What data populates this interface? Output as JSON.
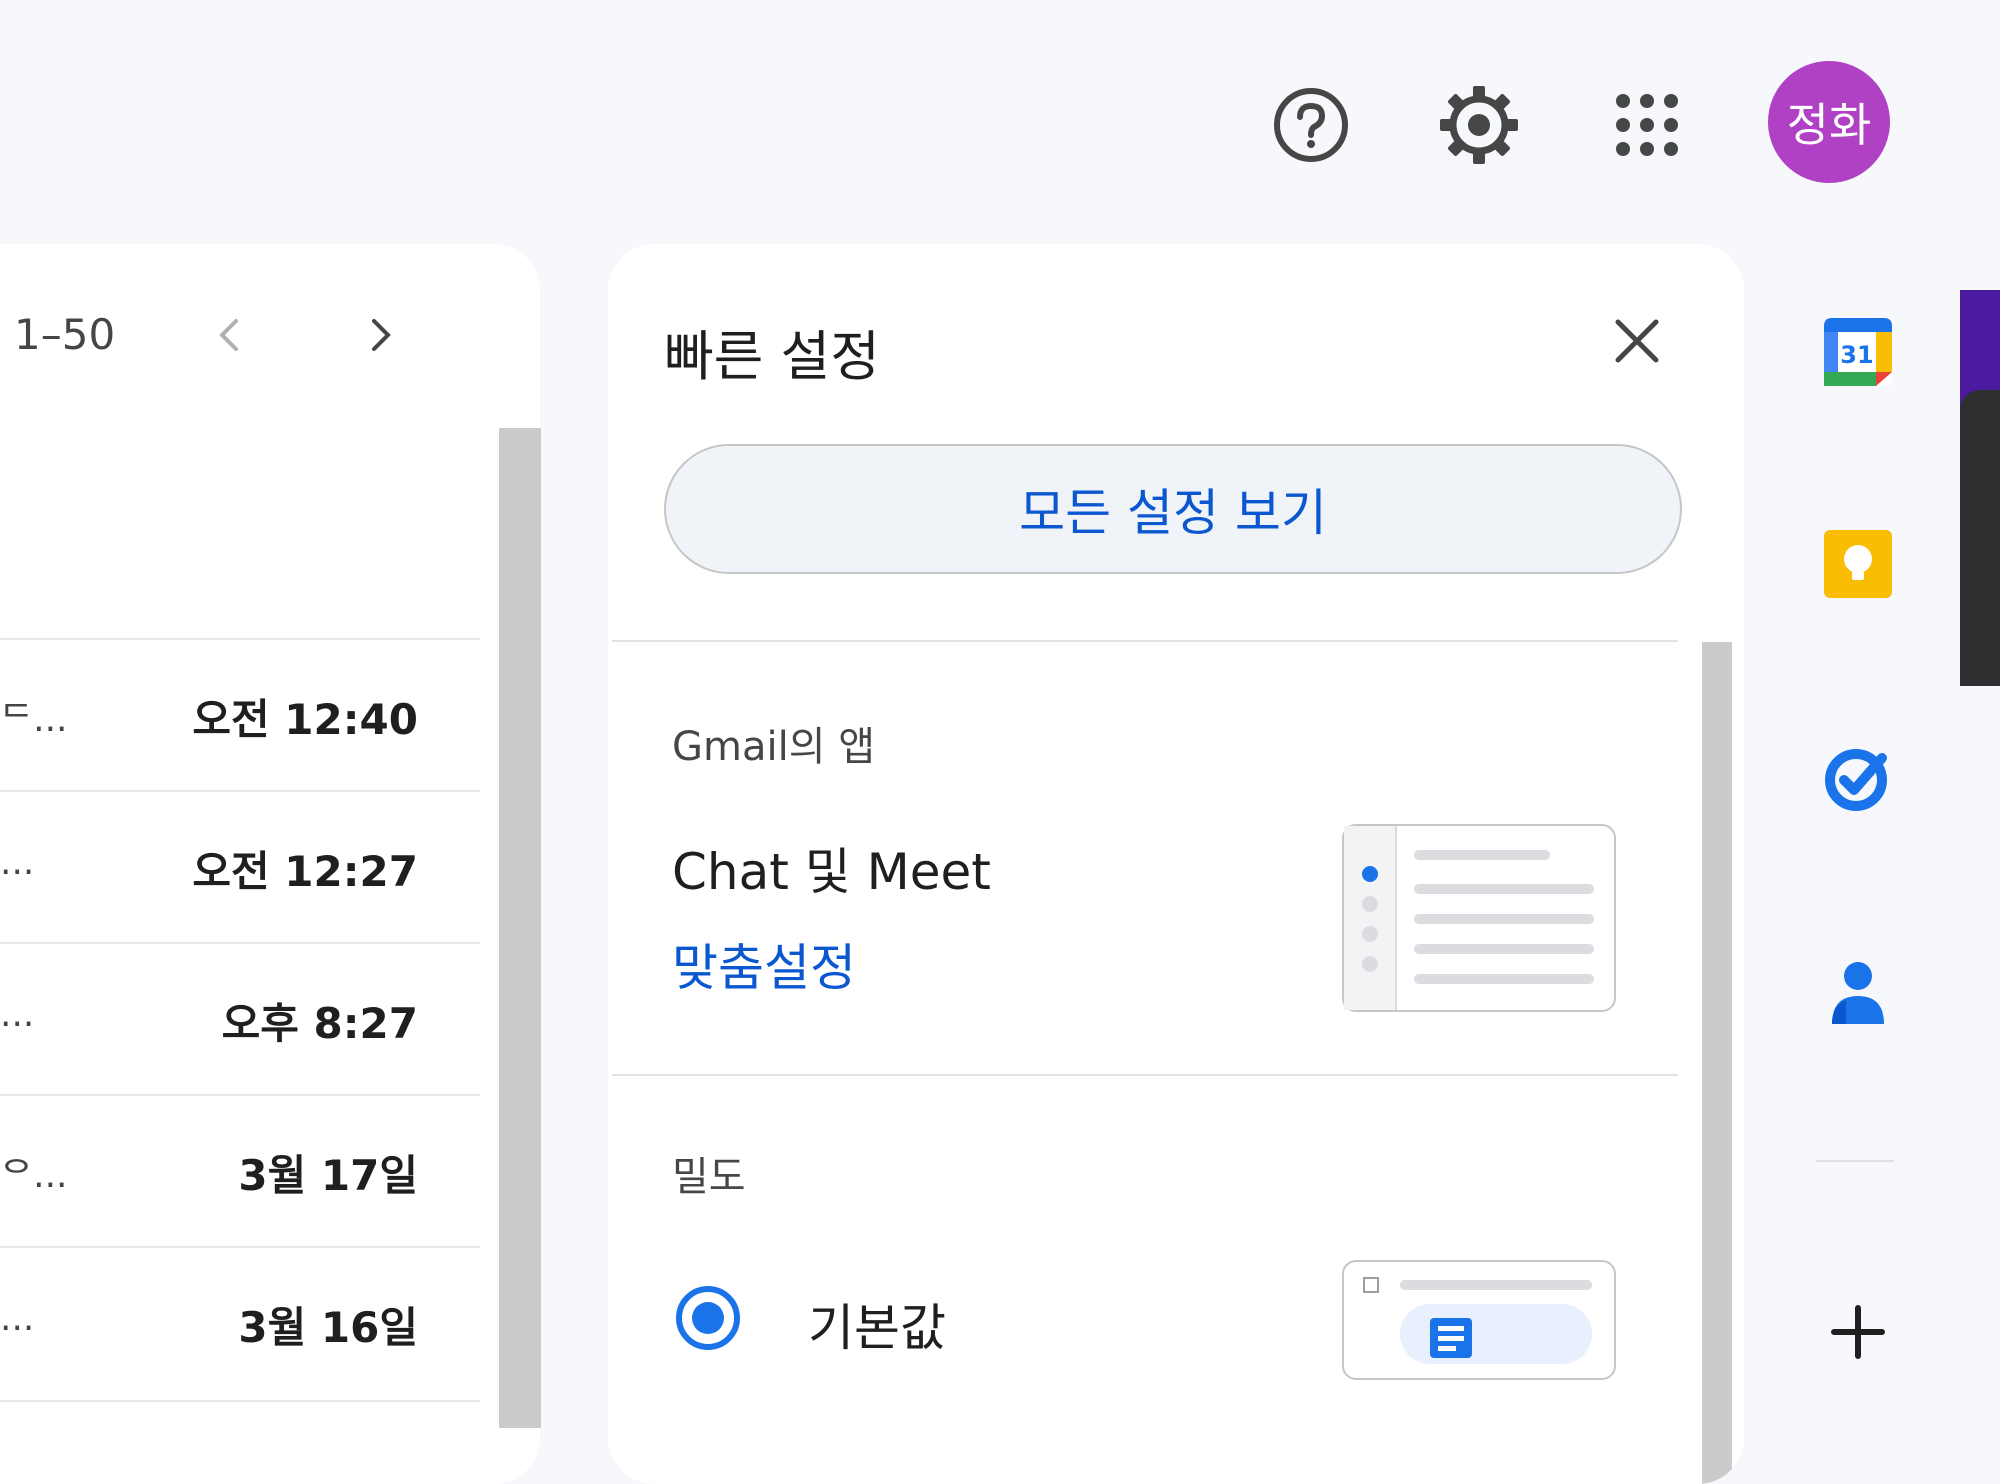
{
  "header": {
    "help_icon": "help-circle-icon",
    "settings_icon": "gear-icon",
    "apps_icon": "apps-grid-icon",
    "avatar_text": "정화",
    "avatar_color": "#b040c4"
  },
  "mail_list": {
    "pager": "1–50",
    "rows": [
      {
        "snippet": "ᄃ...",
        "time": "오전 12:40"
      },
      {
        "snippet": "...",
        "time": "오전 12:27"
      },
      {
        "snippet": "...",
        "time": "오후 8:27"
      },
      {
        "snippet": "ᄋ...",
        "time": "3월 17일"
      },
      {
        "snippet": "...",
        "time": "3월 16일"
      }
    ]
  },
  "quick_settings": {
    "title": "빠른 설정",
    "all_settings_button": "모든 설정 보기",
    "apps_section_label": "Gmail의 앱",
    "chat_meet_label": "Chat 및 Meet",
    "customize_link": "맞춤설정",
    "density_section_label": "밀도",
    "density_option_default": "기본값"
  },
  "side_panel": {
    "apps": [
      "calendar-icon",
      "keep-icon",
      "tasks-icon",
      "contacts-icon"
    ],
    "add_icon": "plus-icon"
  },
  "colors": {
    "accent_blue": "#0b57d0",
    "radio_blue": "#1a73e8",
    "background": "#f6f8fc"
  }
}
